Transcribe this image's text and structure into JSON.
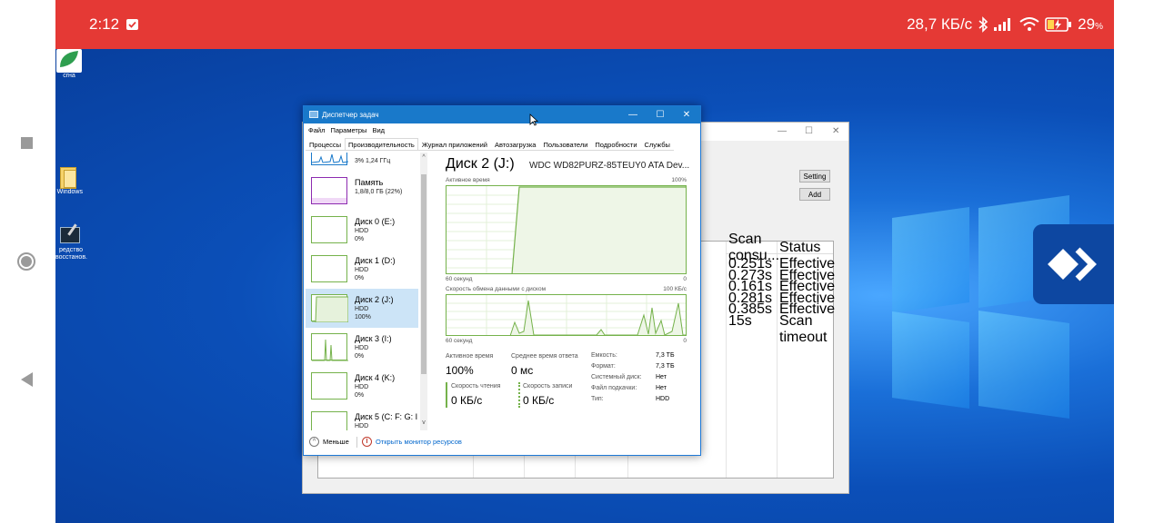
{
  "status_bar": {
    "time": "2:12",
    "network_speed": "28,7 КБ/с",
    "battery": "29",
    "battery_unit": "%",
    "icons": [
      "checkbox-notification-icon",
      "bluetooth-icon",
      "signal-icon",
      "wifi-icon",
      "battery-icon"
    ]
  },
  "desktop": {
    "icons": [
      {
        "label": "сrна",
        "icon": "app-leaf-icon"
      },
      {
        "label": "Windows",
        "icon": "folder-icon"
      },
      {
        "label": "редство\nвосстанов.",
        "icon": "tool-icon"
      }
    ]
  },
  "bg_window": {
    "buttons": [
      "Setting",
      "Add"
    ],
    "columns": [
      "Scan consu...",
      "Status"
    ],
    "rows": [
      [
        "0.251s",
        "Effective"
      ],
      [
        "0.273s",
        "Effective"
      ],
      [
        "0.161s",
        "Effective"
      ],
      [
        "0.281s",
        "Effective"
      ],
      [
        "0.385s",
        "Effective"
      ],
      [
        "15s",
        "Scan timeout"
      ]
    ]
  },
  "task_manager": {
    "title": "Диспетчер задач",
    "menu": [
      "Файл",
      "Параметры",
      "Вид"
    ],
    "tabs": [
      "Процессы",
      "Производительность",
      "Журнал приложений",
      "Автозагрузка",
      "Пользователи",
      "Подробности",
      "Службы"
    ],
    "active_tab": "Производительность",
    "list": [
      {
        "title": "",
        "line1": "3% 1,24 ГГц",
        "line2": ""
      },
      {
        "title": "Память",
        "line1": "1,8/8,0 ГБ (22%)",
        "line2": ""
      },
      {
        "title": "Диск 0 (E:)",
        "line1": "HDD",
        "line2": "0%"
      },
      {
        "title": "Диск 1 (D:)",
        "line1": "HDD",
        "line2": "0%"
      },
      {
        "title": "Диск 2 (J:)",
        "line1": "HDD",
        "line2": "100%"
      },
      {
        "title": "Диск 3 (I:)",
        "line1": "HDD",
        "line2": "0%"
      },
      {
        "title": "Диск 4 (K:)",
        "line1": "HDD",
        "line2": "0%"
      },
      {
        "title": "Диск 5 (C: F: G: I",
        "line1": "HDD",
        "line2": ""
      }
    ],
    "detail": {
      "title": "Диск 2 (J:)",
      "model": "WDC WD82PURZ-85TEUY0 ATA Dev...",
      "graph1_label": "Активное время",
      "graph1_max": "100%",
      "graph1_time": "60 секунд",
      "graph1_min": "0",
      "graph2_label": "Скорость обмена данными с диском",
      "graph2_max": "100 КБ/с",
      "graph2_time": "60 секунд",
      "graph2_min": "0",
      "active_time_label": "Активное время",
      "active_time_value": "100%",
      "avg_response_label": "Среднее время ответа",
      "avg_response_value": "0 мс",
      "read_speed_label": "Скорость чтения",
      "read_speed_value": "0 КБ/с",
      "write_speed_label": "Скорость записи",
      "write_speed_value": "0 КБ/с",
      "properties": [
        {
          "label": "Емкость:",
          "value": "7,3 ТБ"
        },
        {
          "label": "Формат:",
          "value": "7,3 ТБ"
        },
        {
          "label": "Системный диск:",
          "value": "Нет"
        },
        {
          "label": "Файл подкачки:",
          "value": "Нет"
        },
        {
          "label": "Тип:",
          "value": "HDD"
        }
      ]
    },
    "footer": {
      "less": "Меньше",
      "monitor": "Открыть монитор ресурсов"
    }
  }
}
